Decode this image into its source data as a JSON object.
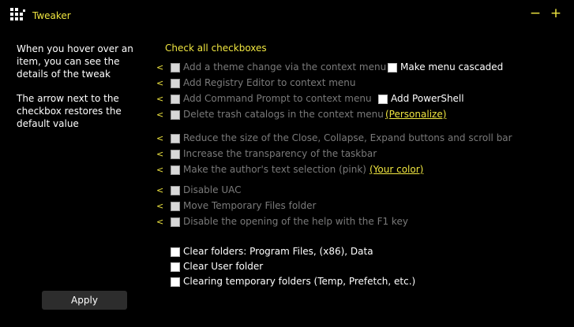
{
  "window": {
    "title": "Tweaker",
    "minimize": "−",
    "maximize": "+"
  },
  "help": {
    "hover_text": "When you hover over an item, you can see the details of the tweak",
    "arrow_text": "The arrow next to the checkbox restores the default value"
  },
  "check_all": "Check all checkboxes",
  "arrow_glyph": "<",
  "tweaks": {
    "t1": {
      "label": "Add a theme change via the context menu",
      "extra": "Make menu cascaded"
    },
    "t2": {
      "label": "Add Registry Editor to context menu"
    },
    "t3": {
      "label": "Add Command Prompt to context menu",
      "extra": "Add PowerShell"
    },
    "t4": {
      "label": "Delete trash catalogs in the context menu",
      "link": "(Personalize)"
    },
    "t5": {
      "label": "Reduce the size of the Close, Collapse, Expand buttons and scroll bar"
    },
    "t6": {
      "label": "Increase the transparency of the taskbar"
    },
    "t7": {
      "label": "Make the author's text selection (pink)",
      "link": "(Your color)"
    },
    "t8": {
      "label": "Disable UAC"
    },
    "t9": {
      "label": "Move Temporary Files folder"
    },
    "t10": {
      "label": "Disable the opening of the help with the F1 key"
    }
  },
  "cleanup": {
    "c1": "Clear folders: Program Files, (x86), Data",
    "c2": "Clear User folder",
    "c3": "Clearing temporary folders (Temp, Prefetch, etc.)"
  },
  "apply_label": "Apply",
  "colors": {
    "accent": "#f0e640",
    "background": "#000000",
    "disabled_text": "#7a7a7a"
  }
}
